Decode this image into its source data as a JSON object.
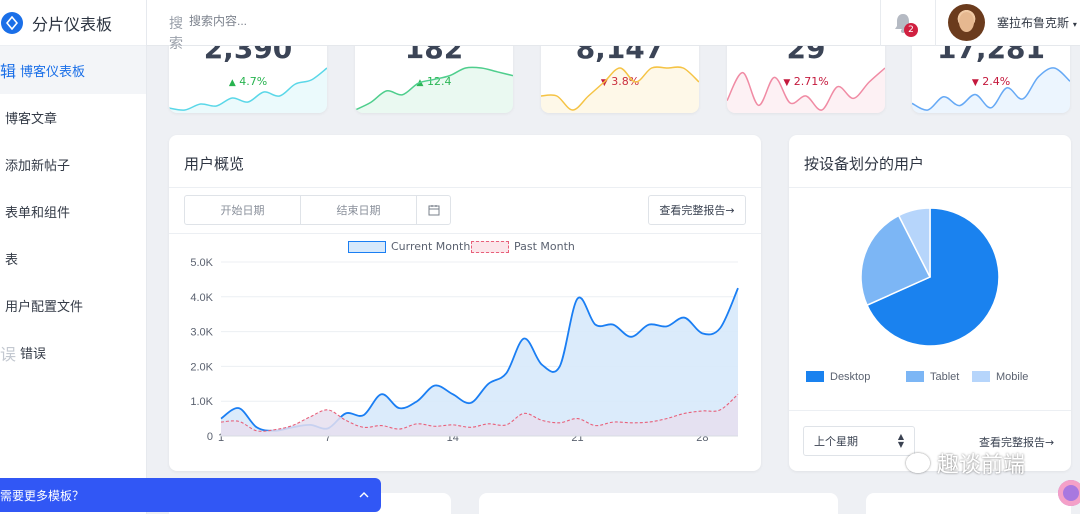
{
  "brand": {
    "title": "分片仪表板"
  },
  "sidebar": {
    "items": [
      {
        "label": "博客仪表板",
        "glyph": "辑",
        "active": true
      },
      {
        "label": "博客文章"
      },
      {
        "label": "添加新帖子"
      },
      {
        "label": "表单和组件"
      },
      {
        "label": "表"
      },
      {
        "label": "用户配置文件"
      },
      {
        "label": "错误",
        "glyph": "误"
      }
    ]
  },
  "header": {
    "search_label": "搜索",
    "search_placeholder": "搜索内容...",
    "notification_count": "2",
    "user_name": "塞拉布鲁克斯"
  },
  "stats": [
    {
      "value": "2,390",
      "delta": "4.7%",
      "direction": "up",
      "color": "#5ad7e8",
      "series": [
        4,
        3,
        6,
        5,
        9,
        7,
        12,
        10,
        16,
        18,
        24
      ]
    },
    {
      "value": "182",
      "delta": "12.4",
      "direction": "up",
      "color": "#4fce8d",
      "series": [
        3,
        5,
        8,
        7,
        10,
        11,
        12,
        14,
        14,
        13,
        12
      ]
    },
    {
      "value": "8,147",
      "delta": "3.8%",
      "direction": "down",
      "color": "#f5c344",
      "series": [
        6,
        6,
        5,
        6,
        7,
        8,
        7,
        8,
        8,
        8,
        7
      ]
    },
    {
      "value": "29",
      "delta": "2.71%",
      "direction": "down",
      "color": "#f08ba4",
      "series": [
        8,
        20,
        6,
        18,
        7,
        10,
        4,
        14,
        9,
        16,
        22
      ]
    },
    {
      "value": "17,281",
      "delta": "2.4%",
      "direction": "down",
      "color": "#66a9f5",
      "series": [
        6,
        3,
        9,
        5,
        10,
        4,
        13,
        8,
        18,
        22,
        16
      ]
    }
  ],
  "colors": {
    "up": "#27b34f",
    "down": "#c4183c",
    "primary": "#1a7ef3"
  },
  "users_panel": {
    "title": "用户概览",
    "start_placeholder": "开始日期",
    "end_placeholder": "结束日期",
    "report_button": "查看完整报告→",
    "legend_current": "Current Month",
    "legend_past": "Past Month"
  },
  "device_panel": {
    "title": "按设备划分的用户",
    "select_value": "上个星期",
    "report_link": "查看完整报告→"
  },
  "promo": {
    "label": "需要更多模板？"
  },
  "watermark": "趣谈前端",
  "chart_data": [
    {
      "type": "area",
      "title": "",
      "xlabel": "",
      "ylabel": "",
      "x_ticks": [
        "1",
        "7",
        "14",
        "21",
        "28"
      ],
      "y_ticks": [
        "0",
        "1.0K",
        "2.0K",
        "3.0K",
        "4.0K",
        "5.0K"
      ],
      "ylim": [
        0,
        5000
      ],
      "xlim": [
        1,
        30
      ],
      "grid": true,
      "legend": "top-center",
      "series": [
        {
          "name": "Current Month",
          "color": "#1a7ef3",
          "fill": "#d7e9fb",
          "x": [
            1,
            2,
            3,
            4,
            5,
            6,
            7,
            8,
            9,
            10,
            11,
            12,
            13,
            14,
            15,
            16,
            17,
            18,
            19,
            20,
            21,
            22,
            23,
            24,
            25,
            26,
            27,
            28,
            29,
            30
          ],
          "values": [
            500,
            800,
            250,
            150,
            250,
            320,
            220,
            650,
            600,
            1200,
            800,
            1000,
            1450,
            1200,
            950,
            1500,
            1800,
            2800,
            2050,
            2000,
            3950,
            3200,
            3200,
            2850,
            3200,
            3150,
            3400,
            2950,
            3100,
            4250
          ]
        },
        {
          "name": "Past Month",
          "color": "#e8607a",
          "fill": "#e6dfee",
          "x": [
            1,
            2,
            3,
            4,
            5,
            6,
            7,
            8,
            9,
            10,
            11,
            12,
            13,
            14,
            15,
            16,
            17,
            18,
            19,
            20,
            21,
            22,
            23,
            24,
            25,
            26,
            27,
            28,
            29,
            30
          ],
          "values": [
            400,
            420,
            150,
            180,
            300,
            550,
            750,
            450,
            250,
            300,
            200,
            350,
            280,
            320,
            250,
            350,
            320,
            650,
            450,
            380,
            500,
            300,
            400,
            380,
            400,
            500,
            650,
            720,
            750,
            1200
          ]
        }
      ]
    },
    {
      "type": "pie",
      "title": "",
      "categories": [
        "Desktop",
        "Tablet",
        "Mobile"
      ],
      "values": [
        68.3,
        24.2,
        7.5
      ],
      "colors": [
        "#1a82ef",
        "#7cb6f5",
        "#b6d5fb"
      ],
      "legend": "bottom"
    }
  ]
}
